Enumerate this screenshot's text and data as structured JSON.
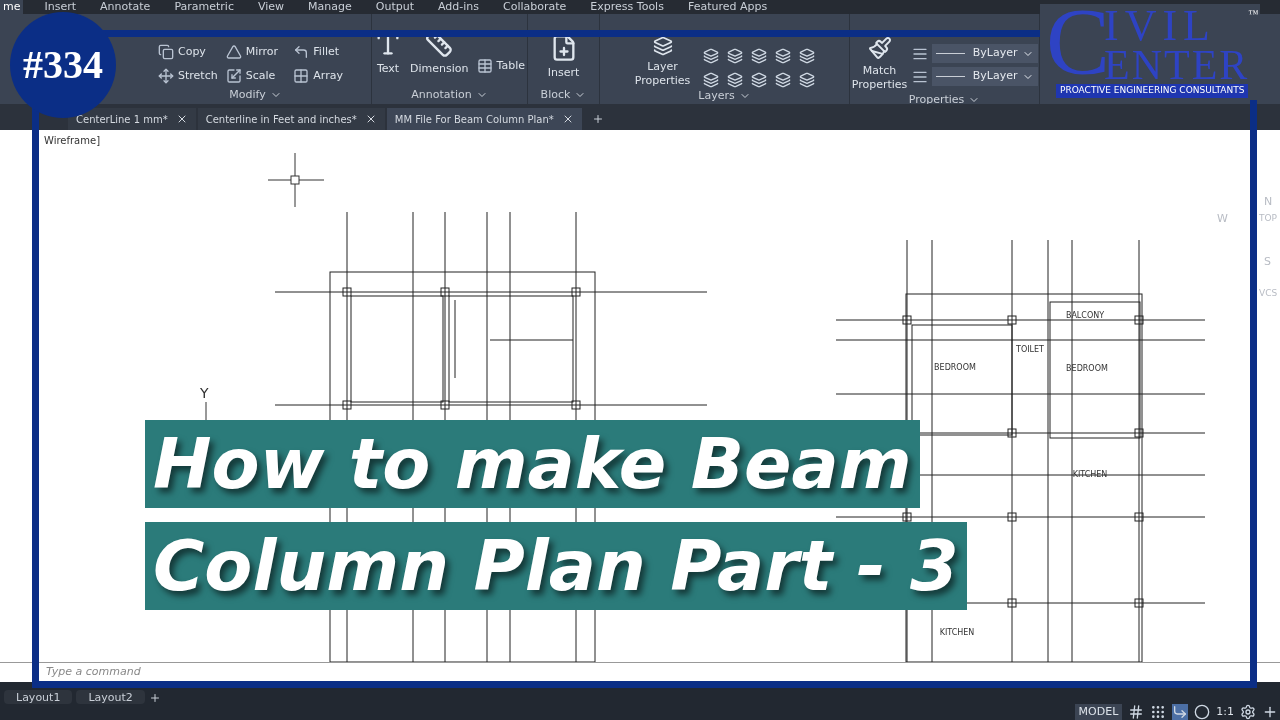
{
  "menu_tabs": [
    {
      "label": "me",
      "selected": true
    },
    {
      "label": "Insert",
      "selected": false
    },
    {
      "label": "Annotate",
      "selected": false
    },
    {
      "label": "Parametric",
      "selected": false
    },
    {
      "label": "View",
      "selected": false
    },
    {
      "label": "Manage",
      "selected": false
    },
    {
      "label": "Output",
      "selected": false
    },
    {
      "label": "Add-ins",
      "selected": false
    },
    {
      "label": "Collaborate",
      "selected": false
    },
    {
      "label": "Express Tools",
      "selected": false
    },
    {
      "label": "Featured Apps",
      "selected": false
    }
  ],
  "ribbon": {
    "panels": [
      {
        "kind": "modify",
        "title": "Modify",
        "tools": [
          "Copy",
          "Mirror",
          "Fillet",
          "Stretch",
          "Scale",
          "Array"
        ]
      },
      {
        "kind": "annotation",
        "title": "Annotation",
        "tools": [
          "Text",
          "Dimension",
          "Table"
        ]
      },
      {
        "kind": "block",
        "title": "Block",
        "tools": [
          "Insert"
        ]
      },
      {
        "kind": "layers",
        "title": "Layers",
        "tools": [
          "Layer Properties"
        ]
      },
      {
        "kind": "properties",
        "title": "Properties",
        "tools": [
          "Match Properties",
          "ByLayer",
          "ByLayer"
        ]
      }
    ]
  },
  "file_tabs": [
    {
      "label": "CenterLine 1 mm*",
      "selected": false
    },
    {
      "label": "Centerline in Feet and inches*",
      "selected": false
    },
    {
      "label": "MM File For Beam Column Plan*",
      "selected": true
    }
  ],
  "canvas": {
    "viewport_label": "Wireframe]",
    "ucs_label": "Y",
    "room_labels": [
      "BALCONY",
      "TOILET",
      "BEDROOM",
      "BEDROOM",
      "KITCHEN",
      "KITCHEN"
    ],
    "viewcube": {
      "north": "N",
      "west": "W",
      "top": "TOP",
      "south": "S",
      "ucs": "VCS"
    }
  },
  "command_line": {
    "placeholder": "Type a command"
  },
  "layout_tabs": [
    {
      "label": "Layout1"
    },
    {
      "label": "Layout2"
    }
  ],
  "status_bar": {
    "mode": "MODEL",
    "scale": "1:1"
  },
  "overlay": {
    "badge": "#334",
    "title_lines": [
      "How to make Beam",
      "Column Plan Part - 3"
    ],
    "logo": {
      "initial": "C",
      "line1": "IVIL",
      "line2": "ENTER",
      "trademark": "™",
      "tagline": "PROACTIVE ENGINEERING CONSULTANTS"
    }
  }
}
